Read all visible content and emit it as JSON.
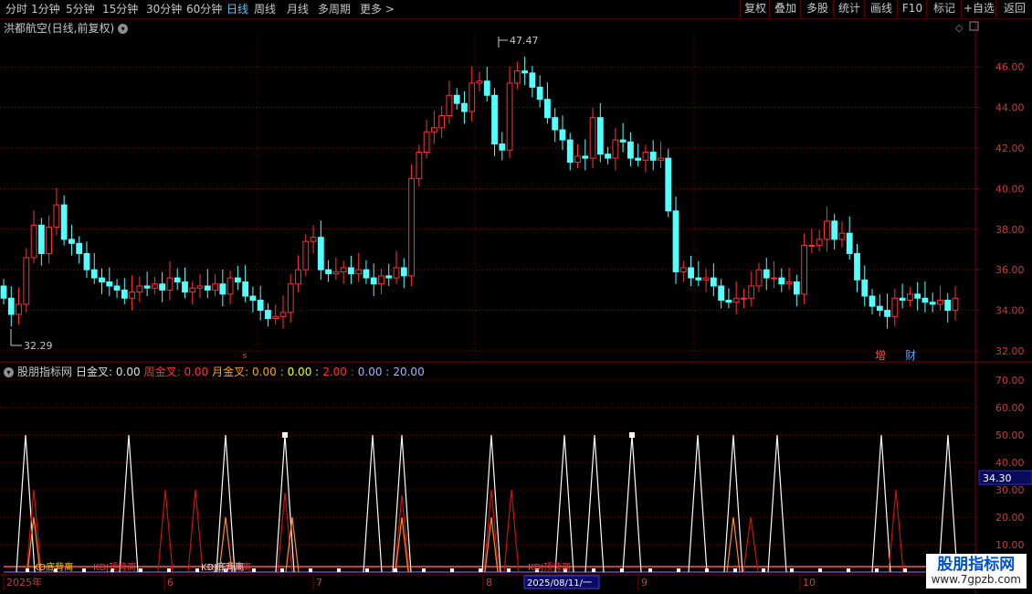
{
  "toolbar": {
    "periods": [
      "分时",
      "1分钟",
      "5分钟",
      "15分钟",
      "30分钟",
      "60分钟",
      "日线",
      "周线",
      "月线",
      "多周期",
      "更多 >"
    ],
    "active_period": "日线",
    "buttons": [
      "复权",
      "叠加",
      "多股",
      "统计",
      "画线",
      "F10",
      "标记",
      "+自选",
      "返回"
    ]
  },
  "stock": {
    "title": "洪都航空(日线,前复权)"
  },
  "main_chart": {
    "price_axis_labels": [
      "46.00",
      "44.00",
      "42.00",
      "40.00",
      "38.00",
      "36.00",
      "34.00",
      "32.00"
    ],
    "high_label": "47.47",
    "low_label": "32.29",
    "markers": {
      "s": "s",
      "increase": "增",
      "finance": "财"
    }
  },
  "indicator": {
    "name": "股朋指标网",
    "items": [
      {
        "label": "日金叉:",
        "value": "0.00",
        "color": "#e0e0e0"
      },
      {
        "label": "周金叉:",
        "value": "0.00",
        "color": "#ff3232"
      },
      {
        "label": "月金叉:",
        "value": "0.00",
        "color": "#ffa500"
      },
      {
        "label": "",
        "value": "0.00",
        "color": "#ffff00"
      },
      {
        "label": "",
        "value": "2.00",
        "color": "#ff3232"
      },
      {
        "label": "",
        "value": "0.00",
        "color": "#b0b0ff"
      },
      {
        "label": "",
        "value": "20.00",
        "color": "#b0b0ff"
      }
    ],
    "axis_labels": [
      "70.00",
      "60.00",
      "50.00",
      "40.00",
      "30.00",
      "20.00",
      "10.00"
    ],
    "current_value": "34.30",
    "signal_labels": [
      {
        "text": "KD底背离",
        "color": "#ffd700"
      },
      {
        "text": "KDJ顶背离",
        "color": "#ff3232"
      },
      {
        "text": "KDJ顶背离",
        "color": "#ff3232"
      },
      {
        "text": "KDJ底背离",
        "color": "#e0e0e0"
      },
      {
        "text": "KDJ顶背离",
        "color": "#ff3232"
      }
    ]
  },
  "time_axis": {
    "labels": [
      "2025年",
      "6",
      "7",
      "8",
      "9",
      "10"
    ],
    "cursor_date": "2025/08/11/一"
  },
  "watermark": {
    "title": "股朋指标网",
    "url": "www.7gpzb.com"
  },
  "colors": {
    "up": "#ff3232",
    "down": "#54ffff",
    "grid": "#7a0000",
    "axis_text": "#c04040",
    "spike_white": "#ffffff",
    "spike_red": "#c81414",
    "spike_orange": "#ff8c1e"
  }
}
